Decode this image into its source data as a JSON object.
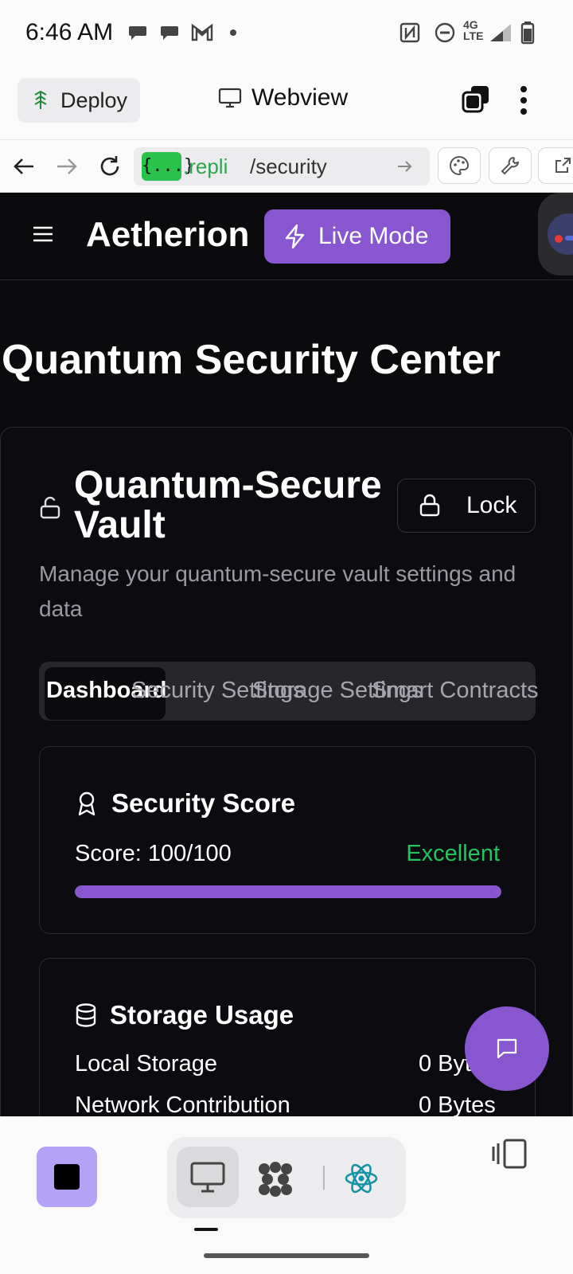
{
  "status_bar": {
    "time": "6:46 AM",
    "network": "4G LTE"
  },
  "replit_header": {
    "deploy_label": "Deploy",
    "webview_label": "Webview"
  },
  "url_bar": {
    "badge": "{...}",
    "host": ".repli",
    "path": "/security"
  },
  "app": {
    "brand": "Aetherion",
    "live_mode_label": "Live Mode",
    "page_title": "Quantum Security Center",
    "vault": {
      "title": "Quantum-Secure Vault",
      "lock_label": "Lock",
      "description": "Manage your quantum-secure vault settings and data",
      "tabs": [
        {
          "label": "Dashboard",
          "active": true
        },
        {
          "label": "Security Settings",
          "active": false
        },
        {
          "label": "Storage Settings",
          "active": false
        },
        {
          "label": "Smart Contracts",
          "active": false
        }
      ],
      "security_score": {
        "title": "Security Score",
        "score_text": "Score: 100/100",
        "status": "Excellent",
        "progress_percent": 100
      },
      "storage_usage": {
        "title": "Storage Usage",
        "rows": [
          {
            "label": "Local Storage",
            "value": "0 Bytes"
          },
          {
            "label": "Network Contribution",
            "value": "0 Bytes"
          }
        ]
      }
    }
  },
  "colors": {
    "accent": "#8857d0",
    "success": "#22c55e",
    "app_bg": "#0b0b0e"
  }
}
